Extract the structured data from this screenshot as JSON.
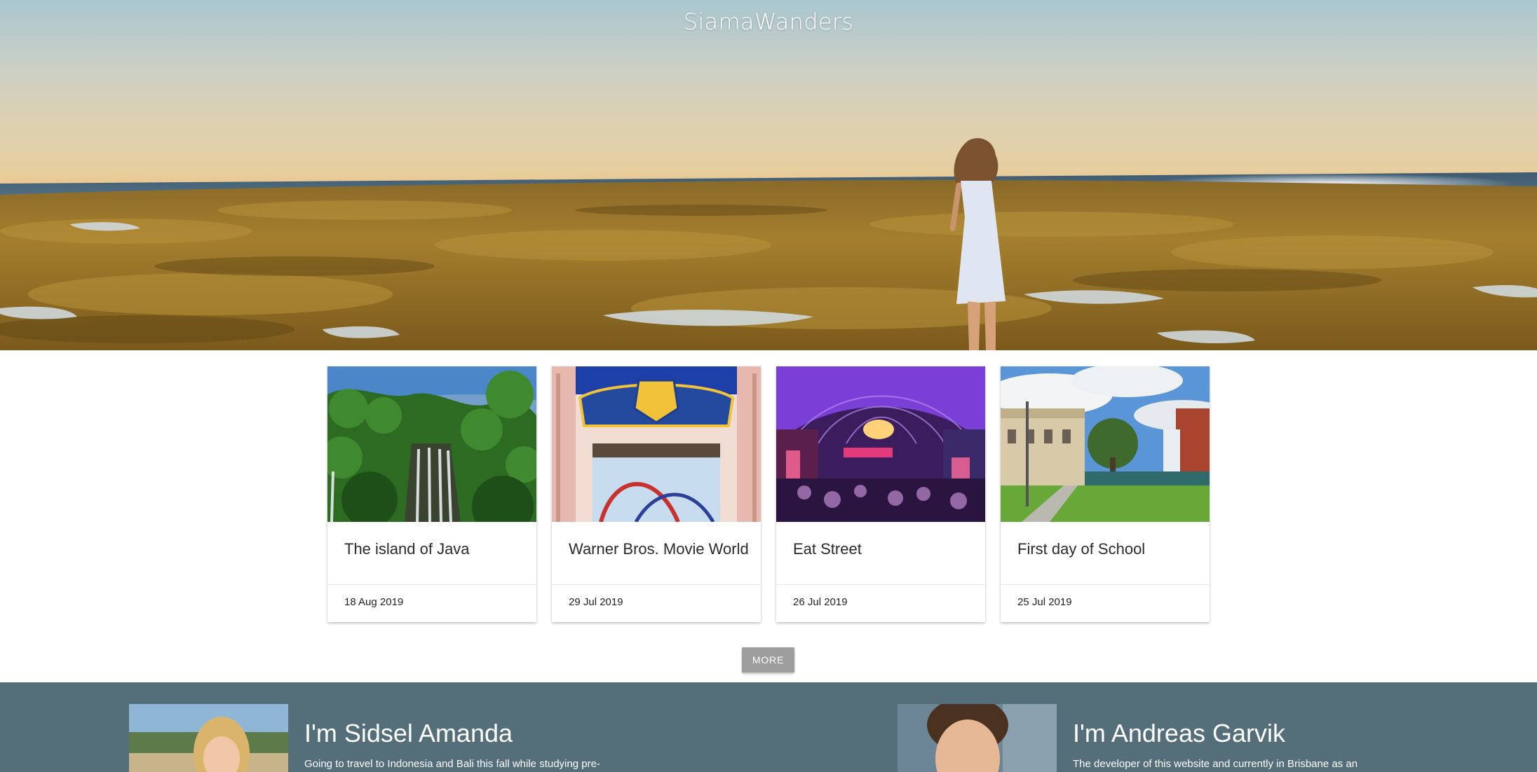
{
  "site": {
    "title": "SiamaWanders"
  },
  "posts": [
    {
      "title": "The island of Java",
      "date": "18 Aug 2019",
      "image": "waterfall-jungle"
    },
    {
      "title": "Warner Bros. Movie World",
      "date": "29 Jul 2019",
      "image": "movie-world-gate"
    },
    {
      "title": "Eat Street",
      "date": "26 Jul 2019",
      "image": "neon-food-market"
    },
    {
      "title": "First day of School",
      "date": "25 Jul 2019",
      "image": "campus-lawn"
    }
  ],
  "more_button": {
    "label": "MORE"
  },
  "authors": [
    {
      "name": "I'm Sidsel Amanda",
      "bio": "Going to travel to Indonesia and Bali this fall while studying pre-"
    },
    {
      "name": "I'm Andreas Garvik",
      "bio": "The developer of this website and currently in Brisbane as an"
    }
  ],
  "colors": {
    "footer_background": "#546e7a",
    "more_button": "#9e9e9e"
  }
}
